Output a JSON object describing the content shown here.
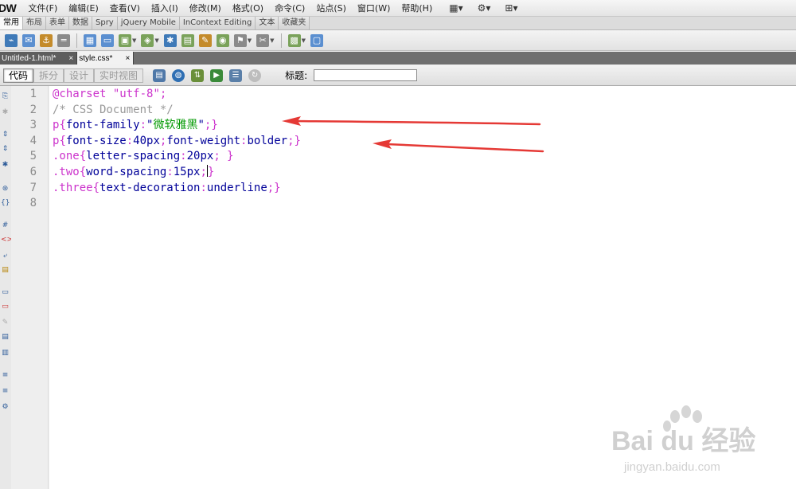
{
  "app": {
    "logo": "DW"
  },
  "menu": [
    "文件(F)",
    "编辑(E)",
    "查看(V)",
    "插入(I)",
    "修改(M)",
    "格式(O)",
    "命令(C)",
    "站点(S)",
    "窗口(W)",
    "帮助(H)"
  ],
  "insert_tabs": [
    "常用",
    "布局",
    "表单",
    "数据",
    "Spry",
    "jQuery Mobile",
    "InContext Editing",
    "文本",
    "收藏夹"
  ],
  "doc_tabs": [
    {
      "name": "Untitled-1.html*",
      "close": "×"
    },
    {
      "name": "style.css*",
      "close": "×"
    }
  ],
  "view_buttons": [
    "代码",
    "拆分",
    "设计",
    "实时视图"
  ],
  "title_label": "标题:",
  "title_value": "",
  "line_numbers": [
    "1",
    "2",
    "3",
    "4",
    "5",
    "6",
    "7",
    "8"
  ],
  "code": {
    "l1_kw": "@charset",
    "l1_str": "\"utf-8\"",
    "l1_end": ";",
    "l2": "/* CSS Document */",
    "l3_sel": "p",
    "l3_prop": "font-family",
    "l3_q1": "\"",
    "l3_val": "微软雅黑",
    "l3_q2": "\"",
    "l4_sel": "p",
    "l4_prop1": "font-size",
    "l4_val1": "40px",
    "l4_prop2": "font-weight",
    "l4_val2": "bolder",
    "l5_sel": ".one",
    "l5_prop": "letter-spacing",
    "l5_val": "20px",
    "l6_sel": ".two",
    "l6_prop": "word-spacing",
    "l6_val": "15px",
    "l7_sel": ".three",
    "l7_prop": "text-decoration",
    "l7_val": "underline"
  },
  "watermark": {
    "brand": "Bai du 经验",
    "url": "jingyan.baidu.com"
  },
  "colors": {
    "annotation_arrow": "#e53935",
    "css_selector": "#cc33cc",
    "css_property": "#000099",
    "css_comment": "#999999"
  }
}
